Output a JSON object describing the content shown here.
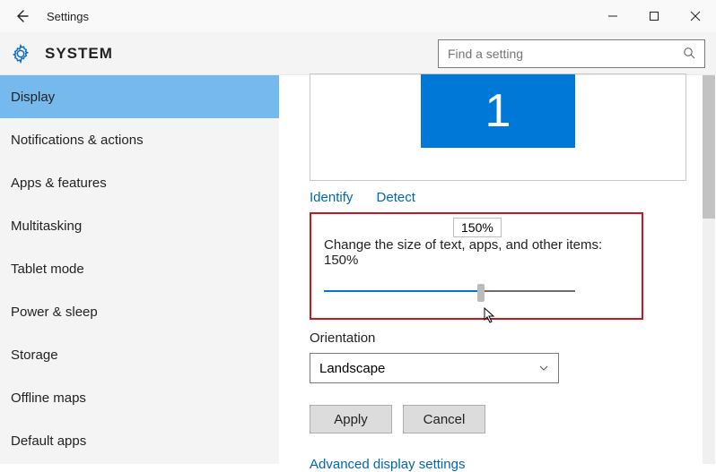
{
  "titlebar": {
    "title": "Settings"
  },
  "header": {
    "system": "SYSTEM",
    "search_placeholder": "Find a setting"
  },
  "sidebar": {
    "items": [
      {
        "label": "Display",
        "active": true
      },
      {
        "label": "Notifications & actions",
        "active": false
      },
      {
        "label": "Apps & features",
        "active": false
      },
      {
        "label": "Multitasking",
        "active": false
      },
      {
        "label": "Tablet mode",
        "active": false
      },
      {
        "label": "Power & sleep",
        "active": false
      },
      {
        "label": "Storage",
        "active": false
      },
      {
        "label": "Offline maps",
        "active": false
      },
      {
        "label": "Default apps",
        "active": false
      }
    ]
  },
  "content": {
    "monitor_number": "1",
    "identify": "Identify",
    "detect": "Detect",
    "scale_tooltip": "150%",
    "scale_label": "Change the size of text, apps, and other items: 150%",
    "scale_value_pct": 62.5,
    "orientation_label": "Orientation",
    "orientation_value": "Landscape",
    "apply": "Apply",
    "cancel": "Cancel",
    "advanced": "Advanced display settings"
  }
}
